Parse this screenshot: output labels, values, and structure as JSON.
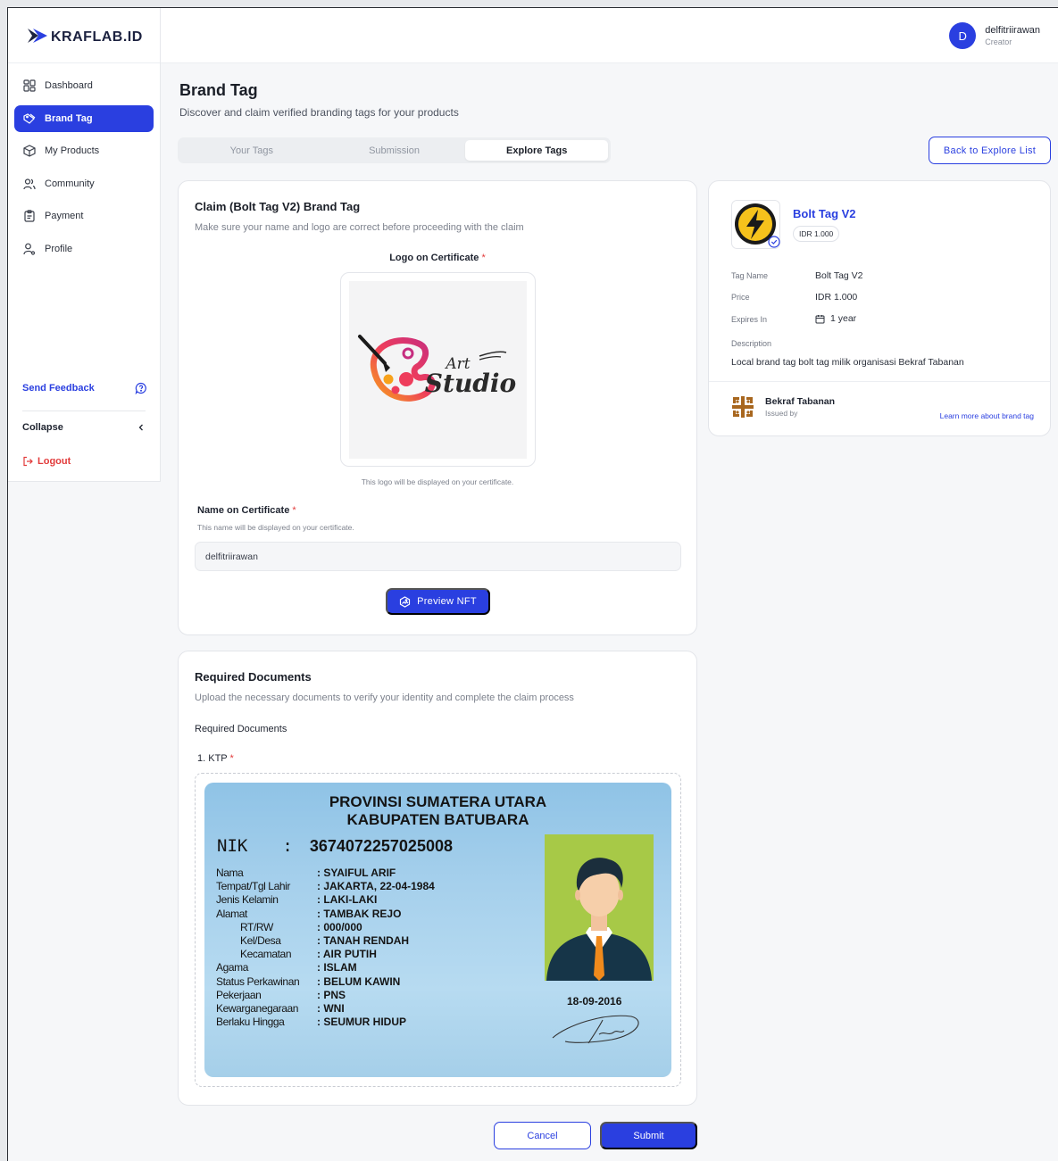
{
  "brand": {
    "logo_text": "KRAFLAB.ID"
  },
  "user": {
    "initial": "D",
    "name": "delfitriirawan",
    "role": "Creator"
  },
  "sidebar": {
    "items": [
      {
        "label": "Dashboard",
        "icon": "grid-icon"
      },
      {
        "label": "Brand Tag",
        "icon": "tag-icon"
      },
      {
        "label": "My Products",
        "icon": "box-icon"
      },
      {
        "label": "Community",
        "icon": "users-icon"
      },
      {
        "label": "Payment",
        "icon": "clipboard-icon"
      },
      {
        "label": "Profile",
        "icon": "user-icon"
      }
    ],
    "feedback": "Send Feedback",
    "collapse": "Collapse",
    "logout": "Logout"
  },
  "header": {
    "title": "Brand Tag",
    "subtitle": "Discover and claim verified branding tags for your products"
  },
  "tabs": [
    {
      "label": "Your Tags"
    },
    {
      "label": "Submission"
    },
    {
      "label": "Explore Tags"
    }
  ],
  "back_button": "Back to Explore List",
  "claim": {
    "title": "Claim (Bolt Tag V2) Brand Tag",
    "subtitle": "Make sure your name and logo are correct before proceeding with the claim",
    "logo_label": "Logo on Certificate",
    "logo_hint": "This logo will be displayed on your certificate.",
    "logo_art_top": "Art",
    "logo_art_bottom": "Studio",
    "name_label": "Name on Certificate",
    "name_hint": "This name will be displayed on your certificate.",
    "name_value": "delfitriirawan",
    "preview_button": "Preview NFT",
    "required_mark": "*"
  },
  "docs": {
    "title": "Required Documents",
    "subtitle": "Upload the necessary documents to verify your identity and complete the claim process",
    "section_label": "Required Documents",
    "item_label": "1. KTP"
  },
  "ktp": {
    "province": "PROVINSI SUMATERA UTARA",
    "regency": "KABUPATEN BATUBARA",
    "nik_label": "NIK",
    "nik_sep": ":",
    "nik": "3674072257025008",
    "rows": [
      {
        "label": "Nama",
        "value": ": SYAIFUL ARIF",
        "indent": false
      },
      {
        "label": "Tempat/Tgl Lahir",
        "value": ": JAKARTA, 22-04-1984",
        "indent": false
      },
      {
        "label": "Jenis Kelamin",
        "value": ": LAKI-LAKI",
        "indent": false
      },
      {
        "label": "Alamat",
        "value": ": TAMBAK REJO",
        "indent": false
      },
      {
        "label": "RT/RW",
        "value": ": 000/000",
        "indent": true
      },
      {
        "label": "Kel/Desa",
        "value": ": TANAH RENDAH",
        "indent": true
      },
      {
        "label": "Kecamatan",
        "value": ": AIR PUTIH",
        "indent": true
      },
      {
        "label": "Agama",
        "value": ": ISLAM",
        "indent": false
      },
      {
        "label": "Status Perkawinan",
        "value": ": BELUM KAWIN",
        "indent": false
      },
      {
        "label": "Pekerjaan",
        "value": ": PNS",
        "indent": false
      },
      {
        "label": "Kewarganegaraan",
        "value": ": WNI",
        "indent": false
      },
      {
        "label": "Berlaku Hingga",
        "value": ": SEUMUR HIDUP",
        "indent": false
      }
    ],
    "date": "18-09-2016"
  },
  "tag_info": {
    "name": "Bolt Tag V2",
    "price_pill": "IDR 1.000",
    "tag_name_label": "Tag Name",
    "tag_name_value": "Bolt Tag V2",
    "price_label": "Price",
    "price_value": "IDR 1.000",
    "expires_label": "Expires In",
    "expires_value": "1 year",
    "description_label": "Description",
    "description_value": "Local brand tag bolt tag milik organisasi Bekraf Tabanan",
    "issuer_name": "Bekraf Tabanan",
    "issuer_role": "Issued by",
    "learn_more": "Learn more about brand tag"
  },
  "actions": {
    "cancel": "Cancel",
    "submit": "Submit"
  },
  "colors": {
    "primary": "#2a3fe0",
    "danger": "#e23b3b"
  }
}
